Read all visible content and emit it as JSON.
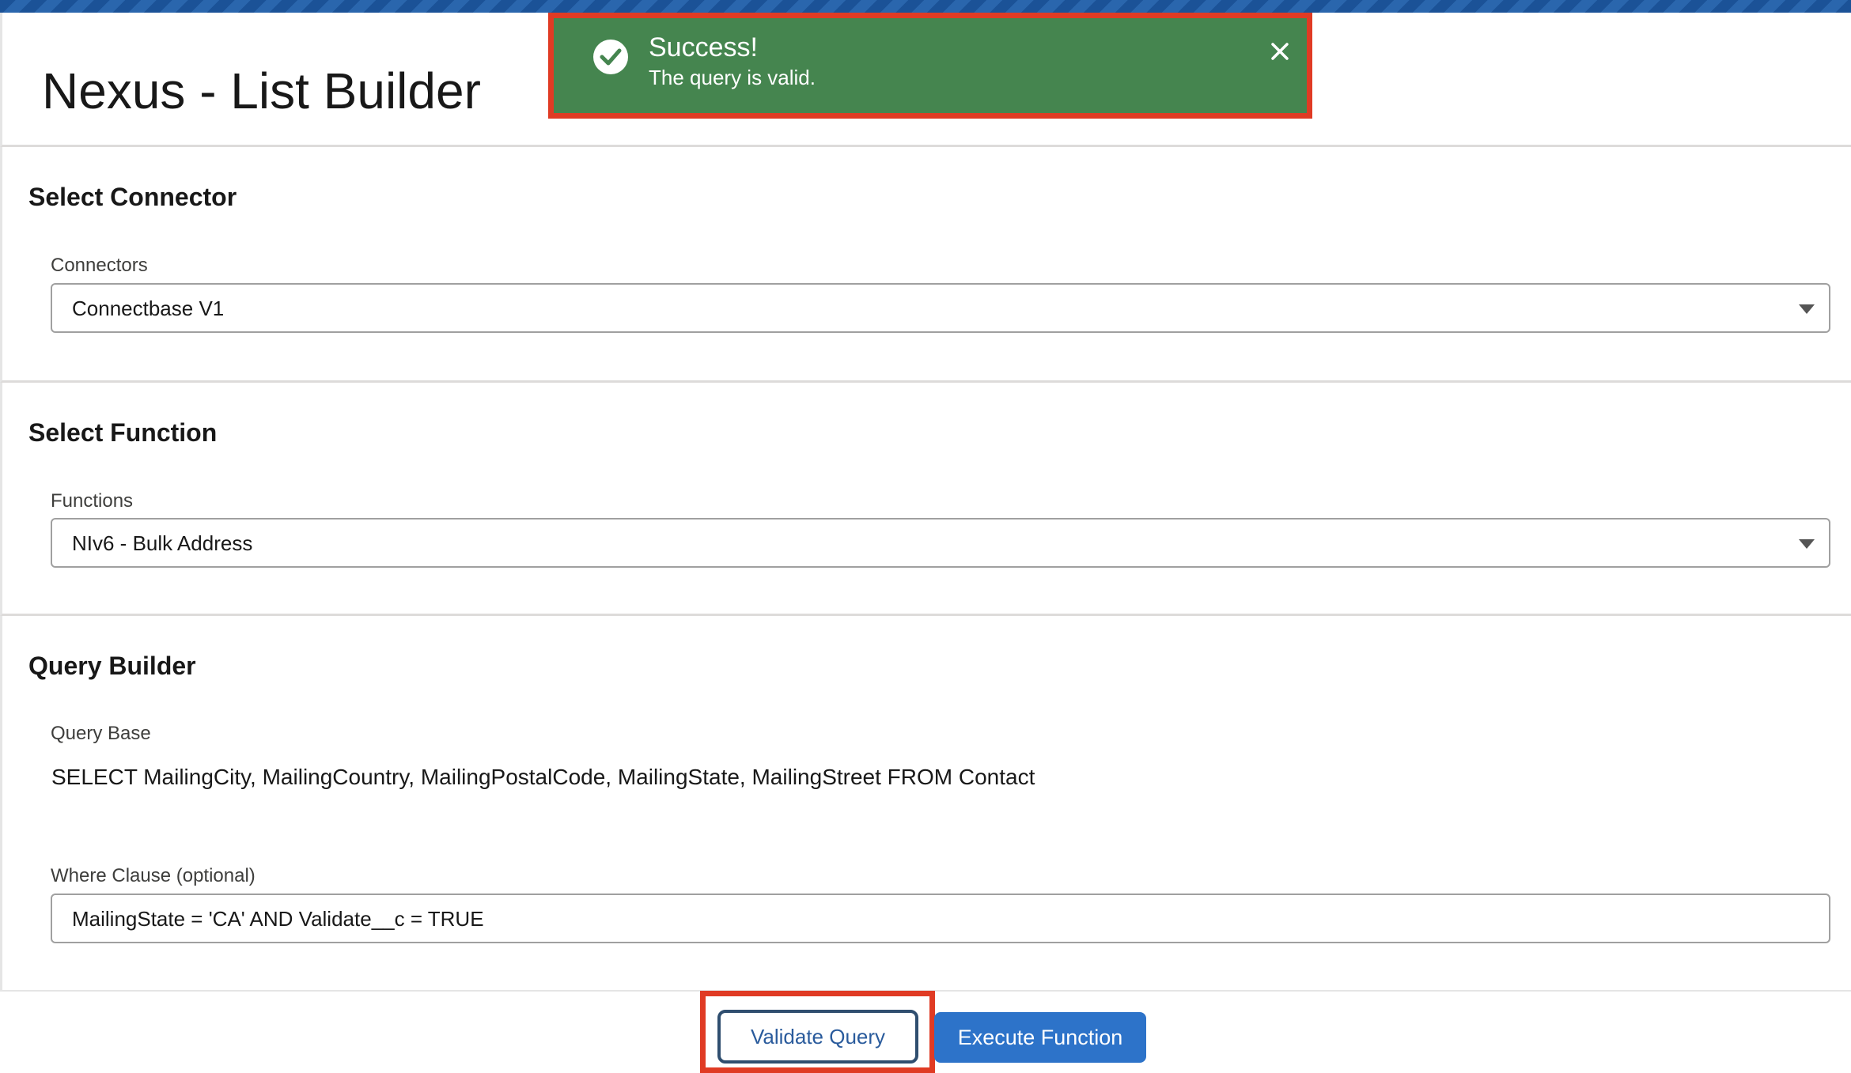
{
  "app": {
    "title": "Nexus - List Builder"
  },
  "toast": {
    "title": "Success!",
    "message": "The query is valid.",
    "icon": "check-circle-icon",
    "close_icon": "close-icon",
    "color": "#45854f"
  },
  "connector_section": {
    "title": "Select Connector",
    "label": "Connectors",
    "value": "Connectbase V1"
  },
  "function_section": {
    "title": "Select Function",
    "label": "Functions",
    "value": "NIv6 - Bulk Address"
  },
  "query_section": {
    "title": "Query Builder",
    "query_base_label": "Query Base",
    "query_base": "SELECT MailingCity, MailingCountry, MailingPostalCode, MailingState, MailingStreet FROM Contact",
    "where_label": "Where Clause (optional)",
    "where_value": "MailingState = 'CA' AND Validate__c = TRUE"
  },
  "actions": {
    "validate_label": "Validate Query",
    "execute_label": "Execute Function",
    "brand_color": "#2d73c9"
  }
}
